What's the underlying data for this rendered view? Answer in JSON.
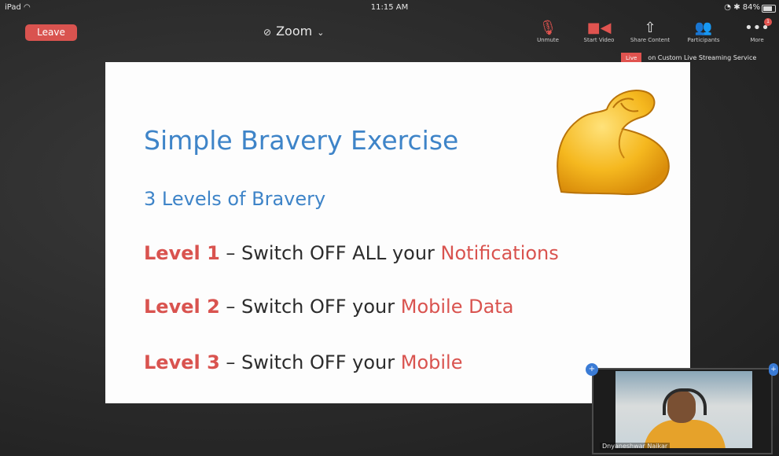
{
  "status_bar": {
    "device": "iPad",
    "time": "11:15 AM",
    "indicators": "84%"
  },
  "toolbar": {
    "leave_label": "Leave",
    "meeting_title": "Zoom",
    "buttons": [
      {
        "label": "Unmute",
        "icon": "mic-muted-icon"
      },
      {
        "label": "Start Video",
        "icon": "video-off-icon"
      },
      {
        "label": "Share Content",
        "icon": "share-icon"
      },
      {
        "label": "Participants",
        "icon": "participants-icon"
      },
      {
        "label": "More",
        "icon": "more-icon",
        "badge": "1"
      }
    ]
  },
  "live_banner": {
    "tag": "Live",
    "text": "on Custom Live Streaming Service"
  },
  "slide": {
    "title": "Simple Bravery Exercise",
    "subtitle": "3 Levels of Bravery",
    "levels": [
      {
        "label": "Level 1",
        "dash": " – ",
        "text": "Switch OFF ALL your ",
        "highlight": "Notifications"
      },
      {
        "label": "Level 2",
        "dash": " – ",
        "text": "Switch OFF your ",
        "highlight": "Mobile Data"
      },
      {
        "label": "Level 3",
        "dash": " – ",
        "text": "Switch OFF your ",
        "highlight": "Mobile"
      }
    ],
    "image": "flexed-biceps-emoji"
  },
  "video_thumbnail": {
    "participant_name": "Dnyaneshwar Naikar"
  },
  "colors": {
    "accent_blue": "#3e84c8",
    "highlight_red": "#d9534f",
    "leave_red": "#d9534f"
  }
}
